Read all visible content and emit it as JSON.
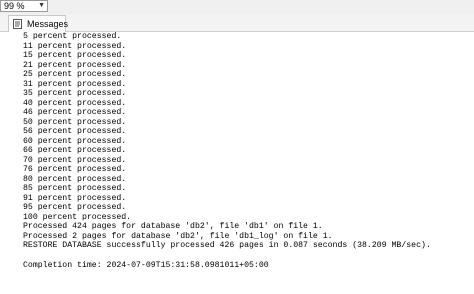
{
  "zoom": {
    "value": "99 %"
  },
  "tabs": [
    {
      "label": "Messages",
      "icon": "messages-icon"
    }
  ],
  "messages": [
    "5 percent processed.",
    "11 percent processed.",
    "15 percent processed.",
    "21 percent processed.",
    "25 percent processed.",
    "31 percent processed.",
    "35 percent processed.",
    "40 percent processed.",
    "46 percent processed.",
    "50 percent processed.",
    "56 percent processed.",
    "60 percent processed.",
    "66 percent processed.",
    "70 percent processed.",
    "76 percent processed.",
    "80 percent processed.",
    "85 percent processed.",
    "91 percent processed.",
    "95 percent processed.",
    "100 percent processed.",
    "Processed 424 pages for database 'db2', file 'db1' on file 1.",
    "Processed 2 pages for database 'db2', file 'db1_log' on file 1.",
    "RESTORE DATABASE successfully processed 426 pages in 0.087 seconds (38.209 MB/sec).",
    "",
    "Completion time: 2024-07-09T15:31:58.0981011+05:00"
  ]
}
